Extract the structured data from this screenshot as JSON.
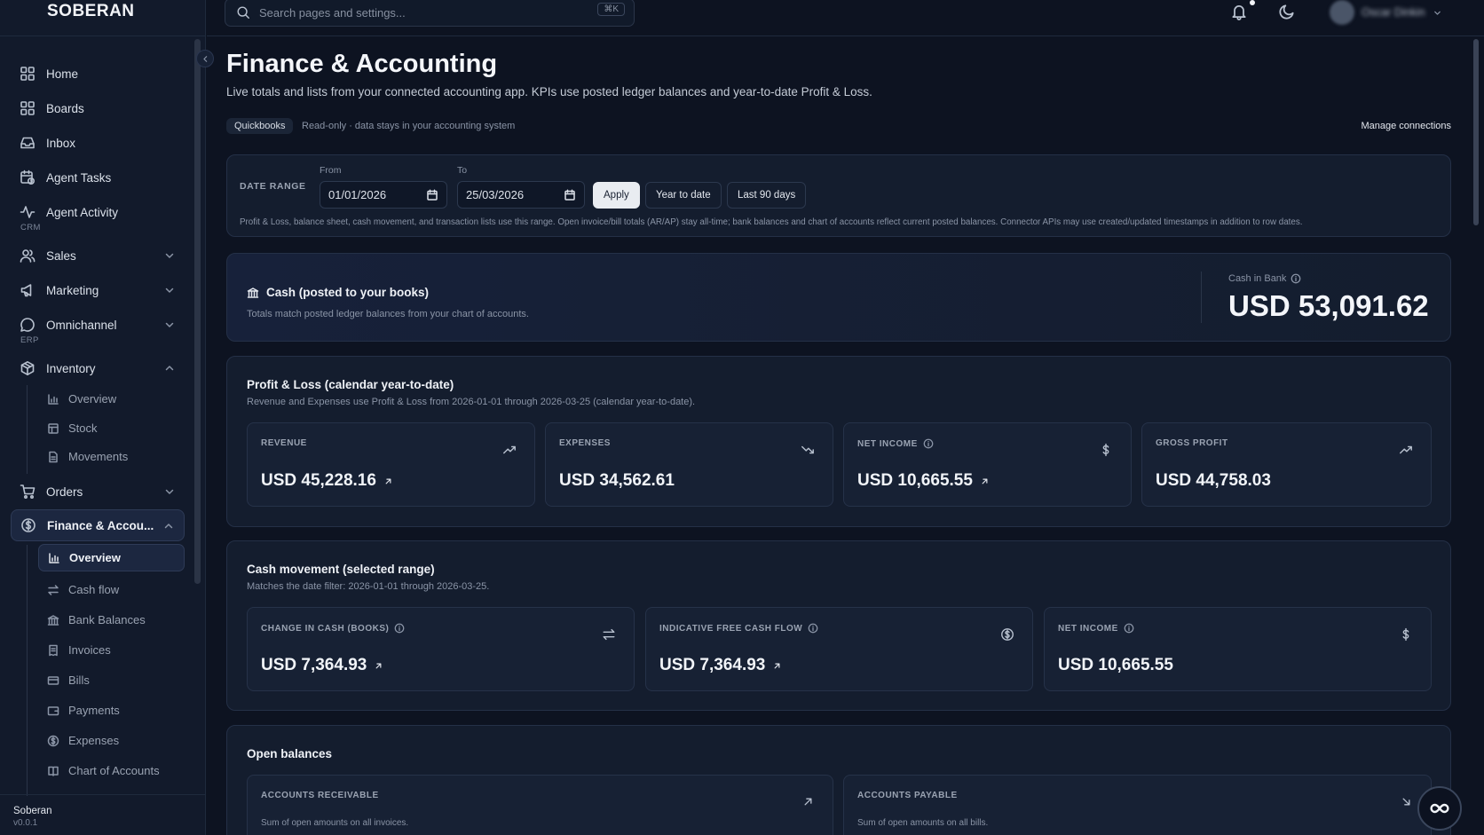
{
  "app": {
    "brand": "SOBERAN",
    "footer_name": "Soberan",
    "version": "v0.0.1"
  },
  "search": {
    "placeholder": "Search pages and settings...",
    "shortcut": "⌘K"
  },
  "user": {
    "name": "Oscar Dinkin"
  },
  "sidebar": {
    "items": [
      {
        "label": "Home",
        "icon": "home-grid-icon"
      },
      {
        "label": "Boards",
        "icon": "boards-grid-icon"
      },
      {
        "label": "Inbox",
        "icon": "inbox-icon"
      },
      {
        "label": "Agent Tasks",
        "icon": "calendar-clock-icon"
      },
      {
        "label": "Agent Activity",
        "icon": "activity-icon"
      }
    ],
    "section_crm": "CRM",
    "crm_items": [
      {
        "label": "Sales",
        "icon": "users-icon"
      },
      {
        "label": "Marketing",
        "icon": "megaphone-icon"
      },
      {
        "label": "Omnichannel",
        "icon": "chat-bubble-icon"
      }
    ],
    "section_erp": "ERP",
    "inventory": {
      "label": "Inventory",
      "icon": "package-icon"
    },
    "inventory_sub": [
      "Overview",
      "Stock",
      "Movements"
    ],
    "orders": {
      "label": "Orders",
      "icon": "cart-icon"
    },
    "finance": {
      "label": "Finance & Accou...",
      "icon": "dollar-circle-icon"
    },
    "finance_sub": [
      "Overview",
      "Cash flow",
      "Bank Balances",
      "Invoices",
      "Bills",
      "Payments",
      "Expenses",
      "Chart of Accounts"
    ]
  },
  "page": {
    "title": "Finance & Accounting",
    "subtitle": "Live totals and lists from your connected accounting app. KPIs use posted ledger balances and year-to-date Profit & Loss.",
    "connector": "Quickbooks",
    "readonly_note": "Read-only · data stays in your accounting system",
    "manage_link": "Manage connections"
  },
  "date_range": {
    "label": "DATE RANGE",
    "from_label": "From",
    "from_value": "01/01/2026",
    "to_label": "To",
    "to_value": "25/03/2026",
    "apply": "Apply",
    "ytd": "Year to date",
    "last90": "Last 90 days",
    "note": "Profit & Loss, balance sheet, cash movement, and transaction lists use this range. Open invoice/bill totals (AR/AP) stay all-time; bank balances and chart of accounts reflect current posted balances. Connector APIs may use created/updated timestamps in addition to row dates."
  },
  "cash": {
    "title": "Cash (posted to your books)",
    "subtitle": "Totals match posted ledger balances from your chart of accounts.",
    "bank_label": "Cash in Bank",
    "bank_value": "USD 53,091.62"
  },
  "pnl": {
    "title": "Profit & Loss (calendar year-to-date)",
    "subtitle": "Revenue and Expenses use Profit & Loss from 2026-01-01 through 2026-03-25 (calendar year-to-date).",
    "kpis": [
      {
        "label": "REVENUE",
        "value": "USD 45,228.16",
        "icon": "trending-up-icon"
      },
      {
        "label": "EXPENSES",
        "value": "USD 34,562.61",
        "icon": "trending-down-icon"
      },
      {
        "label": "NET INCOME",
        "value": "USD 10,665.55",
        "icon": "dollar-icon"
      },
      {
        "label": "GROSS PROFIT",
        "value": "USD 44,758.03",
        "icon": "trending-up-icon"
      }
    ]
  },
  "cash_movement": {
    "title": "Cash movement (selected range)",
    "subtitle": "Matches the date filter: 2026-01-01 through 2026-03-25.",
    "kpis": [
      {
        "label": "CHANGE IN CASH (BOOKS)",
        "value": "USD 7,364.93",
        "icon": "arrows-swap-icon"
      },
      {
        "label": "INDICATIVE FREE CASH FLOW",
        "value": "USD 7,364.93",
        "icon": "dollar-circle-icon"
      },
      {
        "label": "NET INCOME",
        "value": "USD 10,665.55",
        "icon": "dollar-icon"
      }
    ]
  },
  "open_balances": {
    "title": "Open balances",
    "ar": {
      "label": "ACCOUNTS RECEIVABLE",
      "desc": "Sum of open amounts on all invoices."
    },
    "ap": {
      "label": "ACCOUNTS PAYABLE",
      "desc": "Sum of open amounts on all bills."
    }
  }
}
